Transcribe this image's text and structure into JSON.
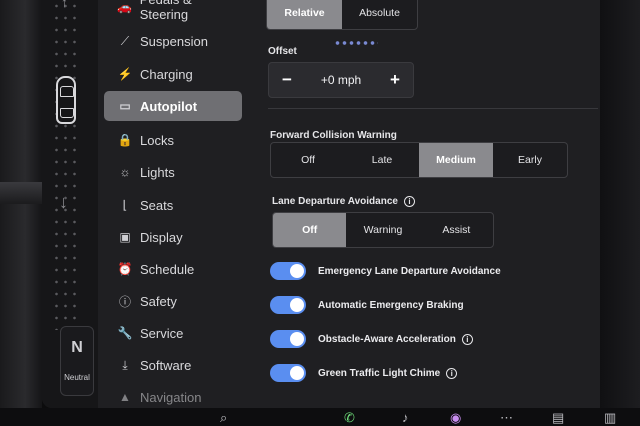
{
  "status_strip": {
    "gear": "N",
    "gear_label": "Neutral"
  },
  "menu": [
    {
      "label": "Pedals & Steering",
      "icon": "car-icon",
      "glyph": "🚗"
    },
    {
      "label": "Suspension",
      "icon": "wrench-icon",
      "glyph": "⟋"
    },
    {
      "label": "Charging",
      "icon": "lightning-icon",
      "glyph": "⚡"
    },
    {
      "label": "Autopilot",
      "icon": "steering-icon",
      "glyph": "▭",
      "active": true
    },
    {
      "label": "Locks",
      "icon": "lock-icon",
      "glyph": "🔒"
    },
    {
      "label": "Lights",
      "icon": "sun-icon",
      "glyph": "☼"
    },
    {
      "label": "Seats",
      "icon": "seat-icon",
      "glyph": "⌊"
    },
    {
      "label": "Display",
      "icon": "display-icon",
      "glyph": "▣"
    },
    {
      "label": "Schedule",
      "icon": "clock-icon",
      "glyph": "⏰"
    },
    {
      "label": "Safety",
      "icon": "alert-icon",
      "glyph": "ⓘ"
    },
    {
      "label": "Service",
      "icon": "wrench-icon",
      "glyph": "🔧"
    },
    {
      "label": "Software",
      "icon": "download-icon",
      "glyph": "⤓"
    },
    {
      "label": "Navigation",
      "icon": "nav-icon",
      "glyph": "▲"
    }
  ],
  "speed_mode": {
    "options": [
      "Relative",
      "Absolute"
    ],
    "selected": "Relative"
  },
  "offset": {
    "label": "Offset",
    "value": "+0 mph",
    "minus": "−",
    "plus": "+"
  },
  "fcw": {
    "label": "Forward Collision Warning",
    "options": [
      "Off",
      "Late",
      "Medium",
      "Early"
    ],
    "selected": "Medium"
  },
  "lda": {
    "label": "Lane Departure Avoidance",
    "options": [
      "Off",
      "Warning",
      "Assist"
    ],
    "selected": "Off"
  },
  "toggles": [
    {
      "label": "Emergency Lane Departure Avoidance",
      "on": true,
      "info": false
    },
    {
      "label": "Automatic Emergency Braking",
      "on": true,
      "info": false
    },
    {
      "label": "Obstacle-Aware Acceleration",
      "on": true,
      "info": true
    },
    {
      "label": "Green Traffic Light Chime",
      "on": true,
      "info": true
    }
  ],
  "colors": {
    "accent": "#5a8ef0",
    "selected_segment": "#8a8a8e",
    "active_menu": "#6f6f73"
  }
}
